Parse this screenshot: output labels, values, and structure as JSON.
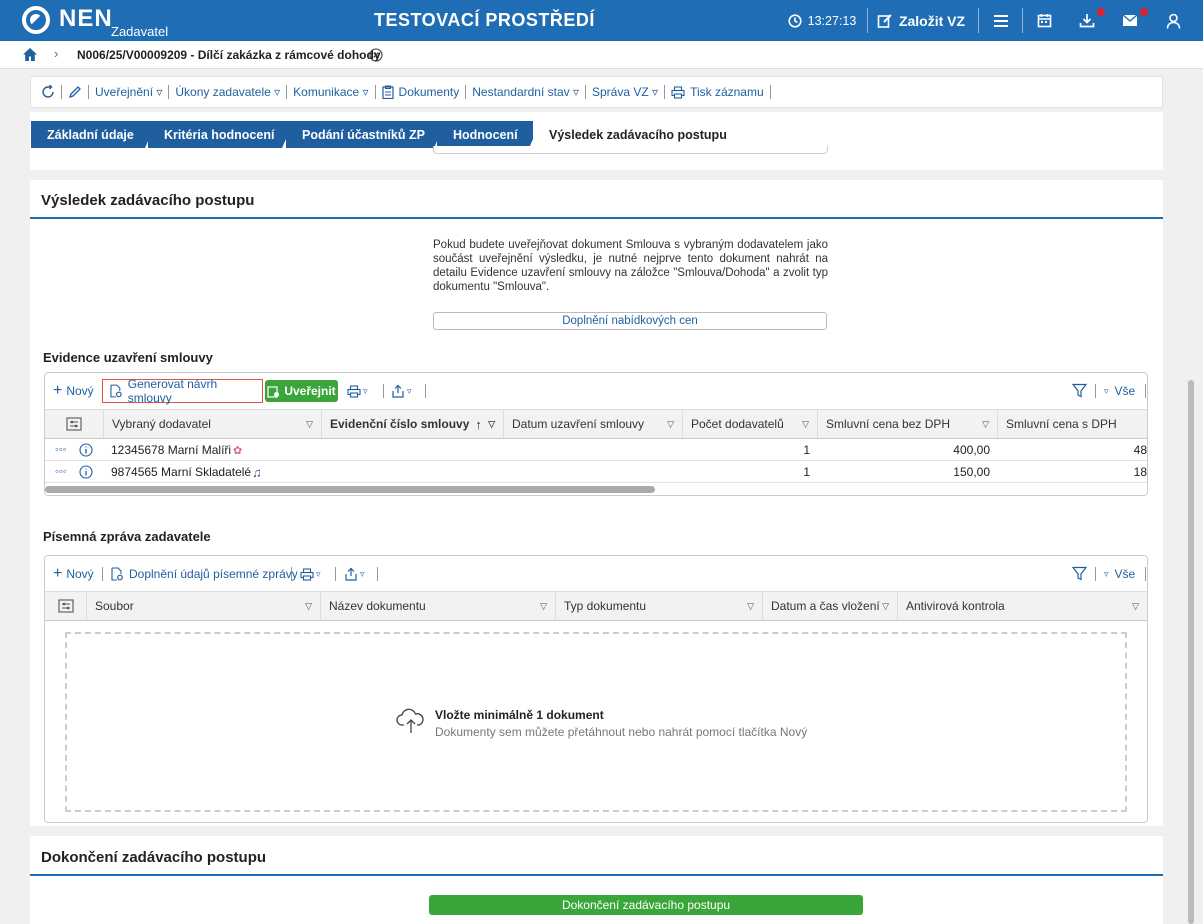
{
  "topbar": {
    "logo": "NEN",
    "logo_sub": "Zadavatel",
    "env_title": "TESTOVACÍ PROSTŘEDÍ",
    "time": "13:27:13",
    "create_label": "Založit VZ"
  },
  "breadcrumb": {
    "text": "N006/25/V00009209 - Dílčí zakázka z rámcové dohody"
  },
  "actions": {
    "publications": "Uveřejnění",
    "acts": "Úkony zadavatele",
    "communication": "Komunikace",
    "documents": "Dokumenty",
    "nonstandard": "Nestandardní stav",
    "management": "Správa VZ",
    "print": "Tisk záznamu"
  },
  "tabs": [
    {
      "label": "Základní údaje"
    },
    {
      "label": "Kritéria hodnocení"
    },
    {
      "label": "Podání účastníků ZP"
    },
    {
      "label": "Hodnocení"
    },
    {
      "label": "Výsledek zadávacího postupu"
    }
  ],
  "result": {
    "title": "Výsledek zadávacího postupu",
    "info": "Pokud budete uveřejňovat dokument Smlouva s vybraným dodavatelem jako součást uveřejnění výsledku, je nutné nejprve tento dokument nahrát na detailu Evidence uzavření smlouvy na záložce \"Smlouva/Dohoda\" a zvolit typ dokumentu \"Smlouva\".",
    "fill_prices": "Doplnění nabídkových cen"
  },
  "contracts": {
    "title": "Evidence uzavření smlouvy",
    "new": "Nový",
    "generate": "Generovat návrh smlouvy",
    "publish": "Uveřejnit",
    "all": "Vše",
    "columns": [
      "Vybraný dodavatel",
      "Evidenční číslo smlouvy",
      "Datum uzavření smlouvy",
      "Počet dodavatelů",
      "Smluvní cena bez DPH",
      "Smluvní cena s DPH"
    ],
    "rows": [
      {
        "supplier": "12345678 Marní Malíři",
        "count": "1",
        "price": "400,00",
        "price_vat": "48"
      },
      {
        "supplier": "9874565 Marní Skladatelé",
        "count": "1",
        "price": "150,00",
        "price_vat": "18"
      }
    ]
  },
  "report": {
    "title": "Písemná zpráva zadavatele",
    "new": "Nový",
    "fill": "Doplnění údajů písemné zprávy",
    "all": "Vše",
    "columns": [
      "Soubor",
      "Název dokumentu",
      "Typ dokumentu",
      "Datum a čas vložení",
      "Antivirová kontrola"
    ],
    "drop_title": "Vložte minimálně 1 dokument",
    "drop_sub": "Dokumenty sem můžete přetáhnout nebo nahrát pomocí tlačítka Nový"
  },
  "completion": {
    "title": "Dokončení zadávacího postupu",
    "button": "Dokončení zadávacího postupu"
  },
  "colors": {
    "primary": "#1f6db5",
    "green": "#3aa63a",
    "red": "#e0202a"
  }
}
